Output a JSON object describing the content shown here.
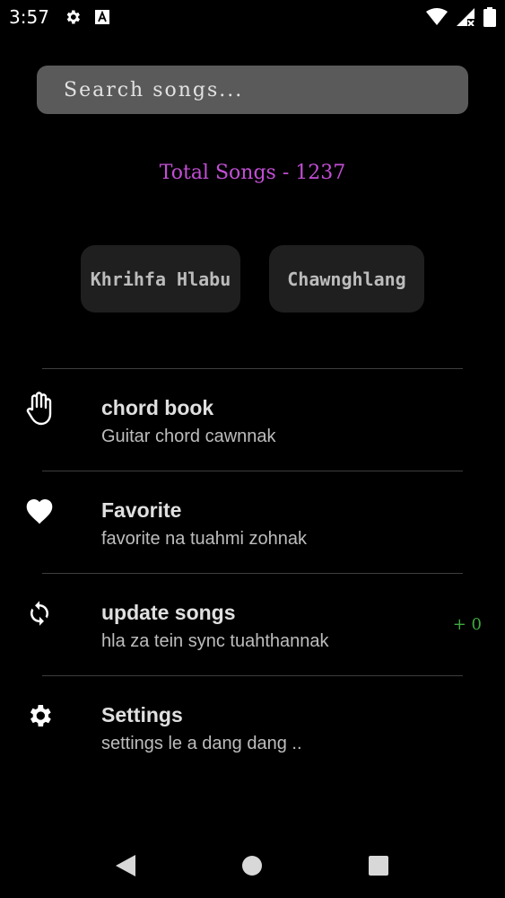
{
  "status_bar": {
    "time": "3:57",
    "icons": [
      "gear-icon",
      "a-font-icon",
      "wifi-icon",
      "signal-no-data-icon",
      "battery-icon"
    ]
  },
  "search": {
    "placeholder": "Search songs..."
  },
  "total_songs": "Total Songs - 1237",
  "buttons": {
    "khrihfa_label": "Khrihfa Hlabu",
    "chawnghlang_label": "Chawnghlang"
  },
  "menu": {
    "items": [
      {
        "icon": "hand-icon",
        "title": "chord book",
        "subtitle": "Guitar chord cawnnak"
      },
      {
        "icon": "heart-icon",
        "title": "Favorite",
        "subtitle": "favorite na tuahmi zohnak"
      },
      {
        "icon": "sync-icon",
        "title": "update songs",
        "subtitle": "hla za tein sync tuahthannak",
        "count": "+ 0"
      },
      {
        "icon": "gear-icon",
        "title": "Settings",
        "subtitle": "settings le a dang dang .."
      }
    ]
  },
  "colors": {
    "background": "#000000",
    "search_bg": "#5a5a5a",
    "accent_purple": "#c24fd4",
    "count_green": "#3fa83f",
    "pill_bg": "#1f1f1f"
  },
  "nav": [
    "back-icon",
    "home-icon",
    "recents-icon"
  ]
}
